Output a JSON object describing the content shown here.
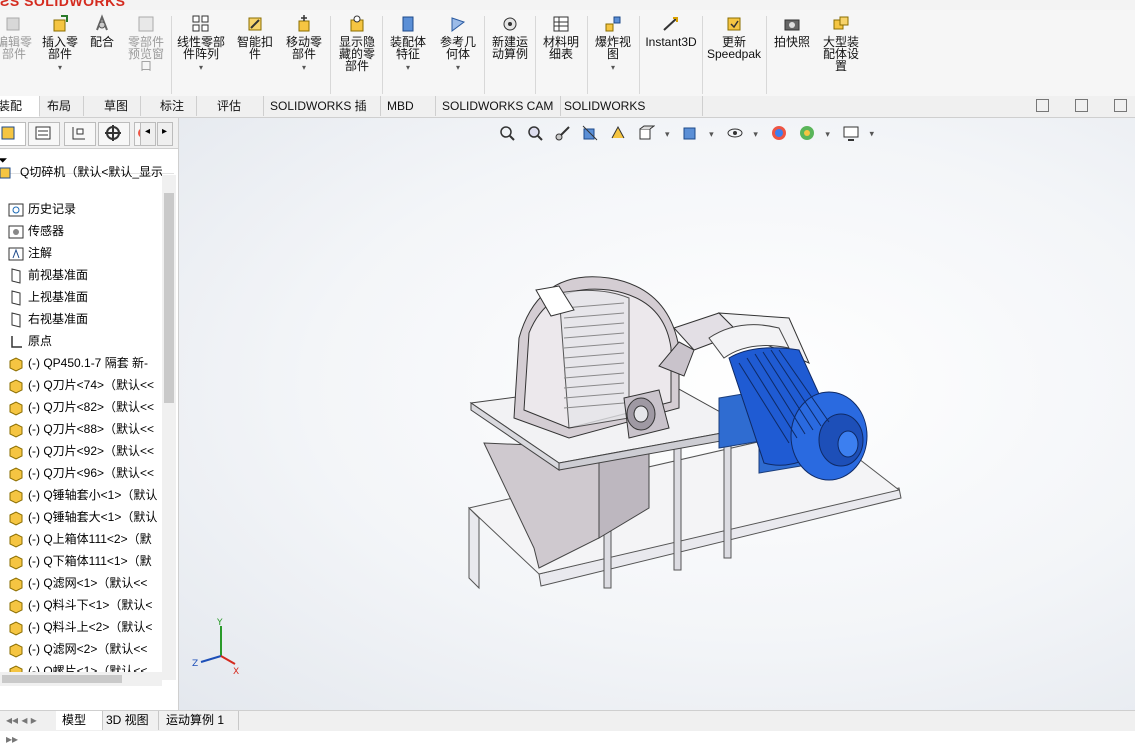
{
  "app": {
    "logo_text": "SOLIDWORKS"
  },
  "ribbon": {
    "buttons": [
      {
        "label": "编辑零\n部件"
      },
      {
        "label": "插入零\n部件"
      },
      {
        "label": "配合"
      },
      {
        "label": "零部件\n预览窗\n口"
      },
      {
        "label": "线性零部\n件阵列"
      },
      {
        "label": "智能扣\n件"
      },
      {
        "label": "移动零\n部件"
      },
      {
        "label": "显示隐\n藏的零\n部件"
      },
      {
        "label": "装配体\n特征"
      },
      {
        "label": "参考几\n何体"
      },
      {
        "label": "新建运\n动算例"
      },
      {
        "label": "材料明\n细表"
      },
      {
        "label": "爆炸视\n图"
      },
      {
        "label": "Instant3D"
      },
      {
        "label": "更新\nSpeedpak"
      },
      {
        "label": "拍快照"
      },
      {
        "label": "大型装\n配体设\n置"
      }
    ]
  },
  "tabs": [
    "装配体",
    "布局",
    "草图",
    "标注",
    "评估",
    "SOLIDWORKS 插件",
    "MBD",
    "SOLIDWORKS CAM",
    "SOLIDWORKS Inspection"
  ],
  "tree": {
    "root": "Q切碎机（默认<默认_显示状",
    "items": [
      {
        "label": "历史记录",
        "icon": "history-icon"
      },
      {
        "label": "传感器",
        "icon": "sensor-icon"
      },
      {
        "label": "注解",
        "icon": "annotation-icon"
      },
      {
        "label": "前视基准面",
        "icon": "plane-icon"
      },
      {
        "label": "上视基准面",
        "icon": "plane-icon"
      },
      {
        "label": "右视基准面",
        "icon": "plane-icon"
      },
      {
        "label": "原点",
        "icon": "origin-icon"
      },
      {
        "label": "(-) QP450.1-7 隔套  新-",
        "icon": "part-icon"
      },
      {
        "label": "(-) Q刀片<74>（默认<<",
        "icon": "part-icon"
      },
      {
        "label": "(-) Q刀片<82>（默认<<",
        "icon": "part-icon"
      },
      {
        "label": "(-) Q刀片<88>（默认<<",
        "icon": "part-icon"
      },
      {
        "label": "(-) Q刀片<92>（默认<<",
        "icon": "part-icon"
      },
      {
        "label": "(-) Q刀片<96>（默认<<",
        "icon": "part-icon"
      },
      {
        "label": "(-) Q锤轴套小<1>（默认",
        "icon": "part-icon"
      },
      {
        "label": "(-) Q锤轴套大<1>（默认",
        "icon": "part-icon"
      },
      {
        "label": "(-) Q上箱体111<2>（默",
        "icon": "part-icon"
      },
      {
        "label": "(-) Q下箱体111<1>（默",
        "icon": "part-icon"
      },
      {
        "label": "(-) Q滤网<1>（默认<<",
        "icon": "part-icon"
      },
      {
        "label": "(-) Q料斗下<1>（默认<",
        "icon": "part-icon"
      },
      {
        "label": "(-) Q料斗上<2>（默认<",
        "icon": "part-icon"
      },
      {
        "label": "(-) Q滤网<2>（默认<<",
        "icon": "part-icon"
      },
      {
        "label": "(-) Q螺片<1>（默认<<",
        "icon": "part-icon"
      }
    ]
  },
  "triad": {
    "x": "X",
    "y": "Y",
    "z": "Z"
  },
  "bottom_tabs": [
    "模型",
    "3D 视图",
    "运动算例 1"
  ]
}
